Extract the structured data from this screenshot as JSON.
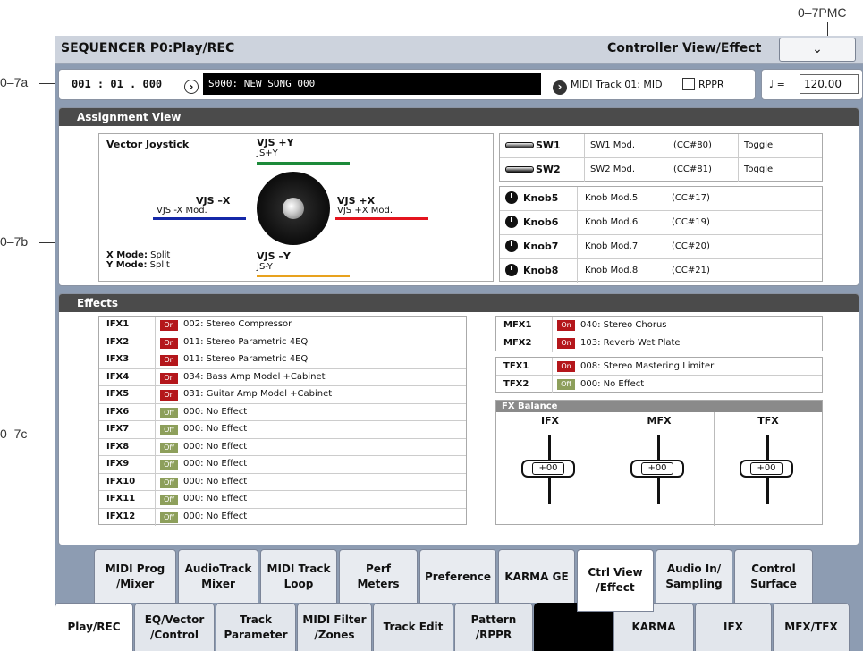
{
  "callouts": {
    "a": "0–7a",
    "b": "0–7b",
    "c": "0–7c",
    "pmc": "0–7PMC"
  },
  "header": {
    "title": "SEQUENCER P0:Play/REC",
    "page": "Controller View/Effect",
    "menu_icon": "chevron-down-icon"
  },
  "location": {
    "position": "001 : 01 . 000",
    "song": "S000: NEW SONG 000",
    "track": "MIDI Track 01: MID",
    "rppr_label": "RPPR",
    "rppr_checked": false
  },
  "tempo": {
    "note": "♩ =",
    "value": "120.00"
  },
  "assignment": {
    "title": "Assignment View",
    "vector_title": "Vector Joystick",
    "vjs_py": "VJS +Y",
    "vjs_py_assign": "JS+Y",
    "vjs_mx": "VJS –X",
    "vjs_mx_assign": "VJS -X Mod.",
    "vjs_px": "VJS +X",
    "vjs_px_assign": "VJS +X Mod.",
    "vjs_my": "VJS –Y",
    "vjs_my_assign": "JS-Y",
    "x_mode_label": "X Mode:",
    "x_mode": "Split",
    "y_mode_label": "Y Mode:",
    "y_mode": "Split",
    "colors": {
      "py": "#1d8a3a",
      "mx": "#1428a8",
      "px": "#e4141e",
      "my": "#e8a21e"
    },
    "switches": [
      {
        "name": "SW1",
        "func": "SW1 Mod.",
        "cc": "(CC#80)",
        "mode": "Toggle"
      },
      {
        "name": "SW2",
        "func": "SW2 Mod.",
        "cc": "(CC#81)",
        "mode": "Toggle"
      }
    ],
    "knobs": [
      {
        "name": "Knob5",
        "func": "Knob Mod.5",
        "cc": "(CC#17)"
      },
      {
        "name": "Knob6",
        "func": "Knob Mod.6",
        "cc": "(CC#19)"
      },
      {
        "name": "Knob7",
        "func": "Knob Mod.7",
        "cc": "(CC#20)"
      },
      {
        "name": "Knob8",
        "func": "Knob Mod.8",
        "cc": "(CC#21)"
      }
    ]
  },
  "effects": {
    "title": "Effects",
    "ifx": [
      {
        "label": "IFX1",
        "state": "On",
        "name": "002: Stereo Compressor"
      },
      {
        "label": "IFX2",
        "state": "On",
        "name": "011: Stereo Parametric 4EQ"
      },
      {
        "label": "IFX3",
        "state": "On",
        "name": "011: Stereo Parametric 4EQ"
      },
      {
        "label": "IFX4",
        "state": "On",
        "name": "034: Bass Amp Model +Cabinet"
      },
      {
        "label": "IFX5",
        "state": "On",
        "name": "031: Guitar Amp Model +Cabinet"
      },
      {
        "label": "IFX6",
        "state": "Off",
        "name": "000: No Effect"
      },
      {
        "label": "IFX7",
        "state": "Off",
        "name": "000: No Effect"
      },
      {
        "label": "IFX8",
        "state": "Off",
        "name": "000: No Effect"
      },
      {
        "label": "IFX9",
        "state": "Off",
        "name": "000: No Effect"
      },
      {
        "label": "IFX10",
        "state": "Off",
        "name": "000: No Effect"
      },
      {
        "label": "IFX11",
        "state": "Off",
        "name": "000: No Effect"
      },
      {
        "label": "IFX12",
        "state": "Off",
        "name": "000: No Effect"
      }
    ],
    "mfx": [
      {
        "label": "MFX1",
        "state": "On",
        "name": "040: Stereo Chorus"
      },
      {
        "label": "MFX2",
        "state": "On",
        "name": "103: Reverb Wet Plate"
      }
    ],
    "tfx": [
      {
        "label": "TFX1",
        "state": "On",
        "name": "008: Stereo Mastering Limiter"
      },
      {
        "label": "TFX2",
        "state": "Off",
        "name": "000: No Effect"
      }
    ],
    "balance": {
      "title": "FX Balance",
      "faders": [
        {
          "label": "IFX",
          "value": "+00"
        },
        {
          "label": "MFX",
          "value": "+00"
        },
        {
          "label": "TFX",
          "value": "+00"
        }
      ]
    }
  },
  "page_tabs": [
    {
      "label": "MIDI Prog\n/Mixer"
    },
    {
      "label": "AudioTrack\nMixer"
    },
    {
      "label": "MIDI Track\nLoop"
    },
    {
      "label": "Perf\nMeters"
    },
    {
      "label": "Preference"
    },
    {
      "label": "KARMA GE"
    },
    {
      "label": "Ctrl View\n/Effect",
      "selected": true
    },
    {
      "label": "Audio In/\nSampling"
    },
    {
      "label": "Control\nSurface"
    }
  ],
  "bottom_tabs": [
    {
      "label": "Play/REC",
      "selected": true
    },
    {
      "label": "EQ/Vector\n/Control"
    },
    {
      "label": "Track\nParameter"
    },
    {
      "label": "MIDI Filter\n/Zones"
    },
    {
      "label": "Track Edit"
    },
    {
      "label": "Pattern\n/RPPR"
    },
    {
      "label": ""
    },
    {
      "label": "KARMA"
    },
    {
      "label": "IFX"
    },
    {
      "label": "MFX/TFX"
    }
  ]
}
